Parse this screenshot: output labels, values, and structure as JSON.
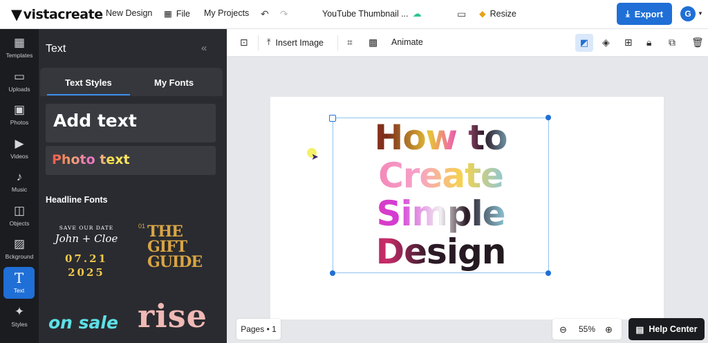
{
  "app": {
    "brand": "vistacreate",
    "nav": {
      "new_design": "New Design",
      "file": "File",
      "my_projects": "My Projects"
    },
    "document_title": "YouTube Thumbnail ...",
    "resize": "Resize",
    "export": "Export",
    "avatar_initial": "G"
  },
  "rail": [
    {
      "label": "Templates",
      "icon": "templates-icon"
    },
    {
      "label": "Uploads",
      "icon": "folder-icon"
    },
    {
      "label": "Photos",
      "icon": "image-icon"
    },
    {
      "label": "Videos",
      "icon": "video-icon"
    },
    {
      "label": "Music",
      "icon": "music-icon"
    },
    {
      "label": "Objects",
      "icon": "shapes-icon"
    },
    {
      "label": "Bckground",
      "icon": "background-icon"
    },
    {
      "label": "Text",
      "icon": "text-icon"
    },
    {
      "label": "Styles",
      "icon": "sparkle-icon"
    }
  ],
  "panel": {
    "title": "Text",
    "tabs": [
      "Text Styles",
      "My Fonts"
    ],
    "add_text": "Add text",
    "photo_text": "Photo text",
    "headline_fonts": "Headline Fonts",
    "fonts": {
      "card1": {
        "line1": "SAVE OUR DATE",
        "line2": "John + Cloe",
        "line3": "07.21",
        "line4": "2025"
      },
      "card2": {
        "number": "01",
        "title": "THE GIFT GUIDE"
      },
      "card3": "on sale",
      "card4": "rise"
    }
  },
  "toolbar": {
    "insert_image": "Insert Image",
    "animate": "Animate"
  },
  "canvas": {
    "headline": [
      "How to",
      "Create",
      "Simple",
      "Design"
    ]
  },
  "footer": {
    "pages": "Pages • 1",
    "zoom": "55%",
    "help": "Help Center"
  },
  "colors": {
    "accent": "#1f6fd6",
    "sidebar": "#1b1c1f",
    "panel": "#2a2b30"
  }
}
